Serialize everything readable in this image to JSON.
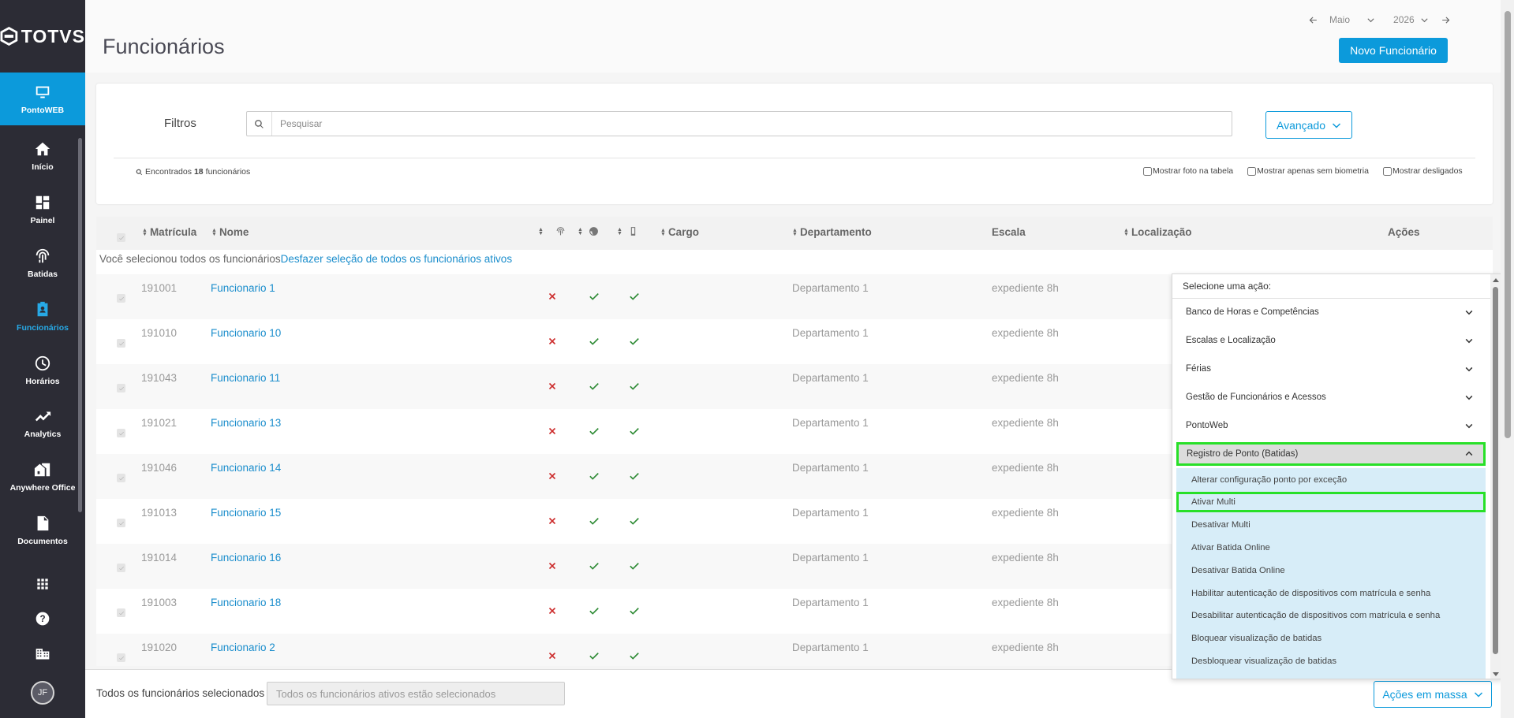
{
  "brand": {
    "logo_text": "TOTVS"
  },
  "sidebar": {
    "items": [
      {
        "label": "PontoWEB",
        "icon": "monitor-icon"
      },
      {
        "label": "Início",
        "icon": "home-icon"
      },
      {
        "label": "Painel",
        "icon": "dashboard-icon"
      },
      {
        "label": "Batidas",
        "icon": "fingerprint-icon"
      },
      {
        "label": "Funcionários",
        "icon": "badge-icon"
      },
      {
        "label": "Horários",
        "icon": "clock-icon"
      },
      {
        "label": "Analytics",
        "icon": "trending-icon"
      },
      {
        "label": "Anywhere Office",
        "icon": "home-work-icon"
      },
      {
        "label": "Documentos",
        "icon": "document-icon"
      }
    ],
    "bottom_icons": [
      "apps-grid-icon",
      "help-icon",
      "building-icon"
    ],
    "avatar_initials": "JF",
    "colors": {
      "background": "#2c2c35",
      "active": "#0c9adb",
      "current": "#27a9e6"
    }
  },
  "header": {
    "title": "Funcionários",
    "month": "Maio",
    "year": "2026",
    "new_button": "Novo Funcionário"
  },
  "filters": {
    "label": "Filtros",
    "search_placeholder": "Pesquisar",
    "advanced_button": "Avançado",
    "found_prefix": "Encontrados",
    "found_count": "18",
    "found_suffix": "funcionários",
    "options": [
      "Mostrar foto na tabela",
      "Mostrar apenas sem biometria",
      "Mostrar desligados"
    ]
  },
  "table": {
    "headers": {
      "matricula": "Matrícula",
      "nome": "Nome",
      "cargo": "Cargo",
      "departamento": "Departamento",
      "escala": "Escala",
      "localizacao": "Localização",
      "acoes": "Ações"
    },
    "selection_text": "Você selecionou todos os funcionários",
    "undo_selection_link": "Desfazer seleção de todos os funcionários ativos",
    "rows": [
      {
        "matricula": "191001",
        "nome": "Funcionario 1",
        "departamento": "Departamento 1",
        "escala": "expediente 8h",
        "biometria": false,
        "web": true,
        "mobile": true
      },
      {
        "matricula": "191010",
        "nome": "Funcionario 10",
        "departamento": "Departamento 1",
        "escala": "expediente 8h",
        "biometria": false,
        "web": true,
        "mobile": true
      },
      {
        "matricula": "191043",
        "nome": "Funcionario 11",
        "departamento": "Departamento 1",
        "escala": "expediente 8h",
        "biometria": false,
        "web": true,
        "mobile": true
      },
      {
        "matricula": "191021",
        "nome": "Funcionario 13",
        "departamento": "Departamento 1",
        "escala": "expediente 8h",
        "biometria": false,
        "web": true,
        "mobile": true
      },
      {
        "matricula": "191046",
        "nome": "Funcionario 14",
        "departamento": "Departamento 1",
        "escala": "expediente 8h",
        "biometria": false,
        "web": true,
        "mobile": true
      },
      {
        "matricula": "191013",
        "nome": "Funcionario 15",
        "departamento": "Departamento 1",
        "escala": "expediente 8h",
        "biometria": false,
        "web": true,
        "mobile": true
      },
      {
        "matricula": "191014",
        "nome": "Funcionario 16",
        "departamento": "Departamento 1",
        "escala": "expediente 8h",
        "biometria": false,
        "web": true,
        "mobile": true
      },
      {
        "matricula": "191003",
        "nome": "Funcionario 18",
        "departamento": "Departamento 1",
        "escala": "expediente 8h",
        "biometria": false,
        "web": true,
        "mobile": true
      },
      {
        "matricula": "191020",
        "nome": "Funcionario 2",
        "departamento": "Departamento 1",
        "escala": "expediente 8h",
        "biometria": false,
        "web": true,
        "mobile": true
      }
    ],
    "colors": {
      "cross": "#cc2a2a",
      "check": "#2e8b35",
      "link": "#1a8dcc"
    }
  },
  "action_menu": {
    "title": "Selecione uma ação:",
    "groups": [
      "Banco de Horas e Competências",
      "Escalas e Localização",
      "Férias",
      "Gestão de Funcionários e Acessos",
      "PontoWeb",
      "Registro de Ponto (Batidas)"
    ],
    "expanded_group": "Registro de Ponto (Batidas)",
    "items": [
      "Alterar configuração ponto por exceção",
      "Ativar Multi",
      "Desativar Multi",
      "Ativar Batida Online",
      "Desativar Batida Online",
      "Habilitar autenticação de dispositivos com matrícula e senha",
      "Desabilitar autenticação de dispositivos com matrícula e senha",
      "Bloquear visualização de batidas",
      "Desbloquear visualização de batidas"
    ],
    "highlighted_item": "Ativar Multi",
    "highlight_color": "#28e028",
    "submenu_background": "#d7edf8"
  },
  "bottom_bar": {
    "label": "Todos os funcionários selecionados",
    "field_value": "Todos os funcionários ativos estão selecionados",
    "bulk_button": "Ações em massa"
  }
}
